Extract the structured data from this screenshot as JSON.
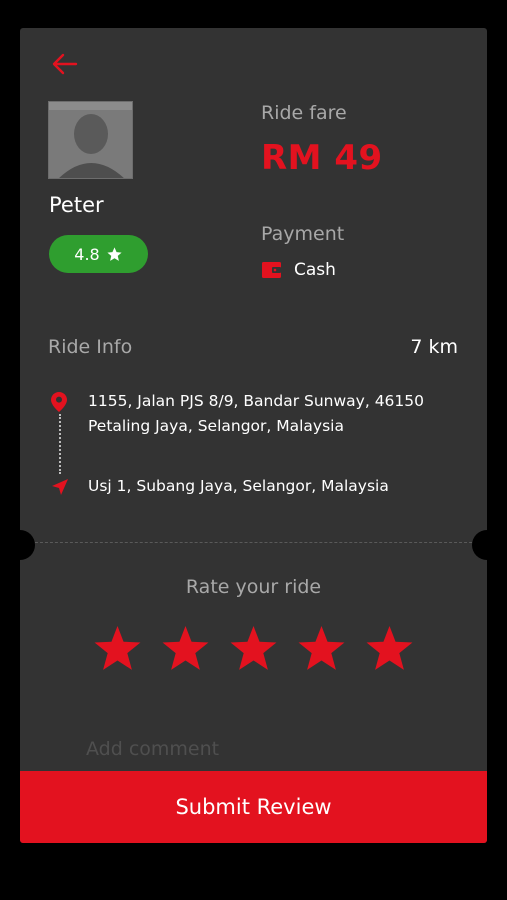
{
  "driver": {
    "name": "Peter",
    "rating": "4.8",
    "rating_icon": "star-icon"
  },
  "fare": {
    "label": "Ride fare",
    "value": "RM 49"
  },
  "payment": {
    "label": "Payment",
    "method": "Cash",
    "icon": "wallet-icon"
  },
  "ride": {
    "label": "Ride Info",
    "distance": "7 km",
    "pickup": "1155, Jalan PJS 8/9, Bandar Sunway, 46150 Petaling Jaya, Selangor, Malaysia",
    "dropoff": "Usj 1, Subang Jaya, Selangor, Malaysia"
  },
  "review": {
    "title": "Rate your ride",
    "stars_total": 5,
    "stars_selected": 5,
    "comment_placeholder": "Add comment",
    "submit_label": "Submit Review"
  },
  "colors": {
    "accent": "#e3121f",
    "card": "#333333",
    "badge_green": "#2f9e2f"
  }
}
